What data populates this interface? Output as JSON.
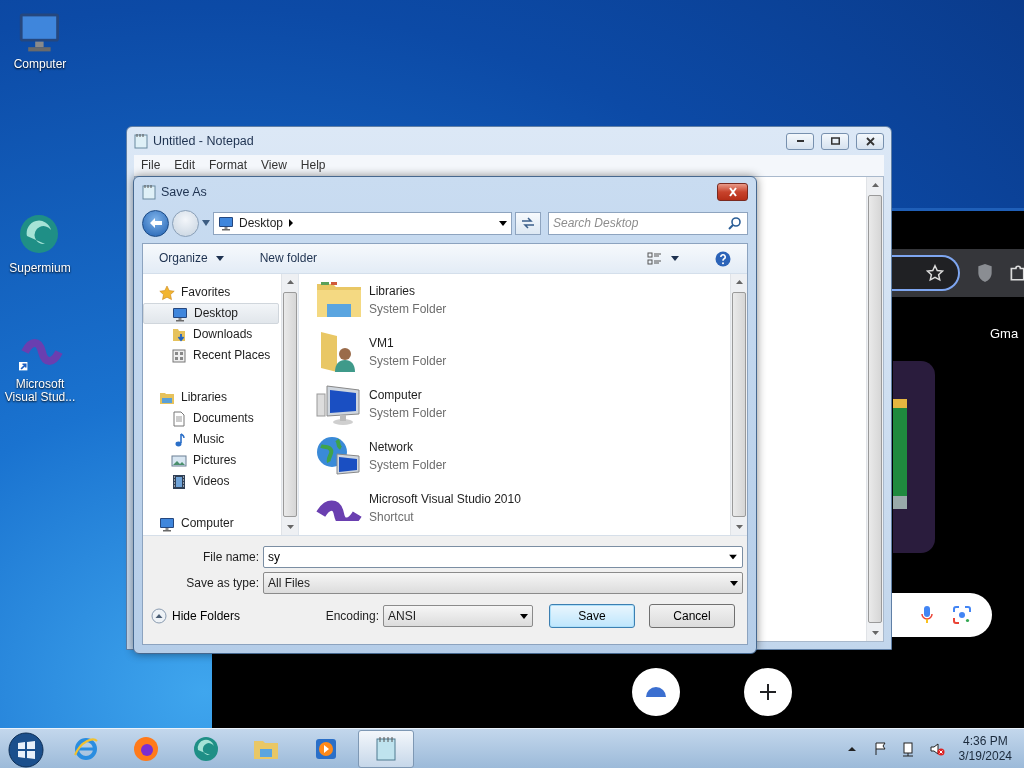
{
  "desktop_icons": [
    {
      "kind": "computer",
      "label": "Computer"
    },
    {
      "kind": "supermium",
      "label": "Supermium"
    },
    {
      "kind": "vs",
      "label": "Microsoft Visual Stud..."
    }
  ],
  "browser": {
    "shortcut_label": "Gma"
  },
  "notepad": {
    "title": "Untitled - Notepad",
    "menu": [
      "File",
      "Edit",
      "Format",
      "View",
      "Help"
    ]
  },
  "save_dialog": {
    "title": "Save As",
    "address": "Desktop",
    "search": {
      "placeholder": "Search Desktop"
    },
    "organize": "Organize",
    "new_folder": "New folder",
    "nav": [
      {
        "kind": "favorites",
        "label": "Favorites",
        "selected": false,
        "children": [
          {
            "kind": "desktop",
            "label": "Desktop",
            "selected": true
          },
          {
            "kind": "downloads",
            "label": "Downloads",
            "selected": false
          },
          {
            "kind": "recent",
            "label": "Recent Places",
            "selected": false
          }
        ]
      },
      {
        "kind": "libraries",
        "label": "Libraries",
        "selected": false,
        "children": [
          {
            "kind": "documents",
            "label": "Documents",
            "selected": false
          },
          {
            "kind": "music",
            "label": "Music",
            "selected": false
          },
          {
            "kind": "pictures",
            "label": "Pictures",
            "selected": false
          },
          {
            "kind": "videos",
            "label": "Videos",
            "selected": false
          }
        ]
      },
      {
        "kind": "computer",
        "label": "Computer",
        "selected": false
      }
    ],
    "files": [
      {
        "kind": "libraries",
        "name": "Libraries",
        "type": "System Folder",
        "selected": false
      },
      {
        "kind": "user",
        "name": "VM1",
        "type": "System Folder",
        "selected": false
      },
      {
        "kind": "computer",
        "name": "Computer",
        "type": "System Folder",
        "selected": false
      },
      {
        "kind": "network",
        "name": "Network",
        "type": "System Folder",
        "selected": false
      },
      {
        "kind": "vs",
        "name": "Microsoft Visual Studio 2010",
        "type": "Shortcut",
        "selected": false
      }
    ],
    "file_name_label": "File name:",
    "file_name": {
      "value": "sy"
    },
    "type_label": "Save as type:",
    "save_as_type": "All Files",
    "hide_folders": "Hide Folders",
    "encoding_label": "Encoding:",
    "encoding": "ANSI",
    "buttons": [
      {
        "kind": "default",
        "label": "Save"
      },
      {
        "kind": "normal",
        "label": "Cancel"
      }
    ]
  },
  "taskbar": {
    "apps": [
      {
        "kind": "ie",
        "selected": false
      },
      {
        "kind": "firefox",
        "selected": false
      },
      {
        "kind": "supermium",
        "selected": false
      },
      {
        "kind": "explorer",
        "selected": false
      },
      {
        "kind": "media",
        "selected": false
      },
      {
        "kind": "notepad",
        "selected": true
      }
    ],
    "time": "4:36 PM",
    "date": "3/19/2024"
  }
}
